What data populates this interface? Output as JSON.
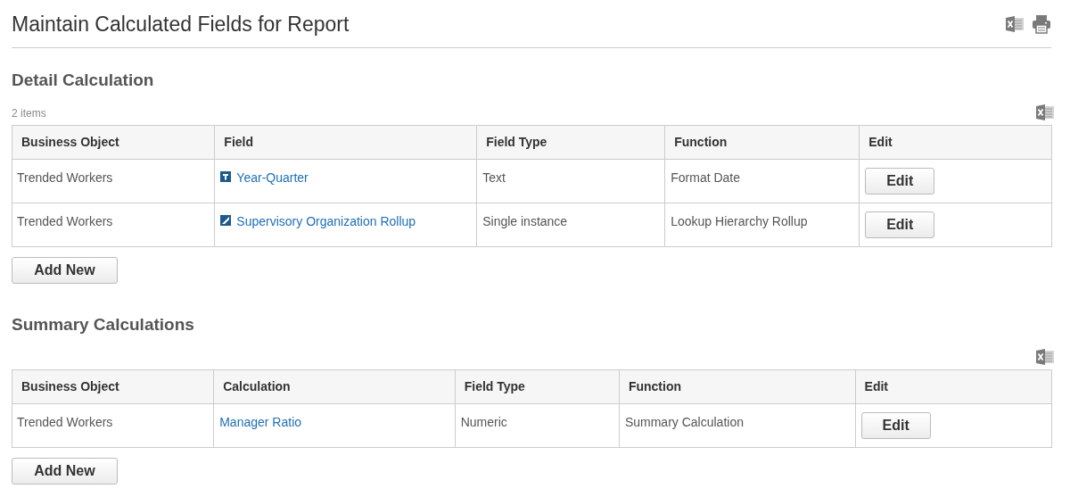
{
  "title": "Maintain Calculated Fields for Report",
  "sections": [
    {
      "heading": "Detail Calculation",
      "count": "2 items",
      "columns": [
        "Business Object",
        "Field",
        "Field Type",
        "Function",
        "Edit"
      ],
      "rows": [
        {
          "object": "Trended Workers",
          "field": "Year-Quarter",
          "kind": "text",
          "type": "Text",
          "function": "Format Date",
          "edit": "Edit"
        },
        {
          "object": "Trended Workers",
          "field": "Supervisory Organization Rollup",
          "kind": "instance",
          "type": "Single instance",
          "function": "Lookup Hierarchy Rollup",
          "edit": "Edit"
        }
      ],
      "add": "Add New"
    },
    {
      "heading": "Summary Calculations",
      "columns": [
        "Business Object",
        "Calculation",
        "Field Type",
        "Function",
        "Edit"
      ],
      "rows": [
        {
          "object": "Trended Workers",
          "field": "Manager Ratio",
          "type": "Numeric",
          "function": "Summary Calculation",
          "edit": "Edit"
        }
      ],
      "add": "Add New"
    }
  ]
}
